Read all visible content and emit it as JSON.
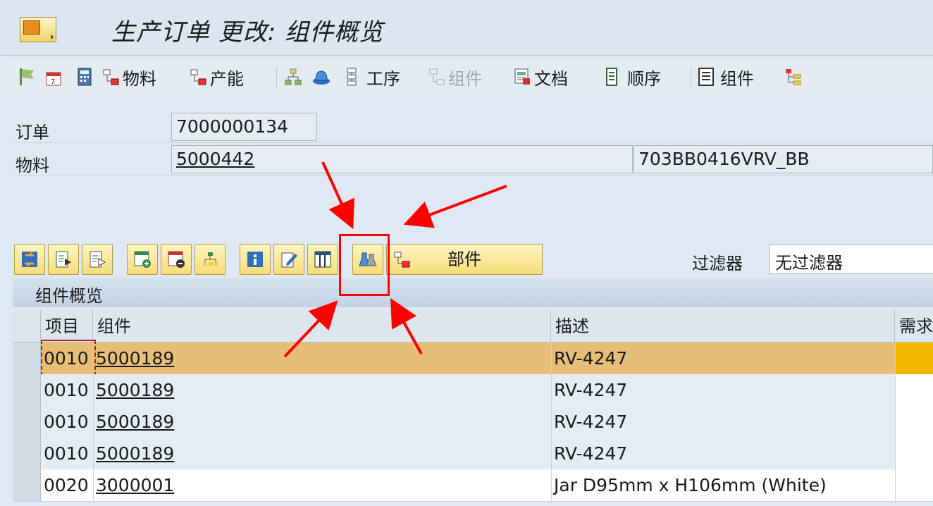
{
  "title": "生产订单 更改: 组件概览",
  "app_toolbar": {
    "material": "物料",
    "capacity": "产能",
    "operations": "工序",
    "components_disabled": "组件",
    "documents": "文档",
    "sequences": "顺序",
    "components": "组件"
  },
  "header": {
    "order_label": "订单",
    "order_value": "7000000134",
    "material_label": "物料",
    "material_value": "5000442",
    "material_desc": "703BB0416VRV_BB"
  },
  "grid_toolbar": {
    "parts_label": "部件",
    "filter_label": "过滤器",
    "filter_value": "无过滤器"
  },
  "grid": {
    "title": "组件概览",
    "columns": {
      "item": "项目",
      "component": "组件",
      "description": "描述",
      "requirement": "需求"
    },
    "rows": [
      {
        "item": "0010",
        "component": "5000189",
        "description": "RV-4247",
        "selected": true
      },
      {
        "item": "0010",
        "component": "5000189",
        "description": "RV-4247",
        "selected": false
      },
      {
        "item": "0010",
        "component": "5000189",
        "description": "RV-4247",
        "selected": false
      },
      {
        "item": "0010",
        "component": "5000189",
        "description": "RV-4247",
        "selected": false
      },
      {
        "item": "0020",
        "component": "3000001",
        "description": "Jar D95mm x H106mm (White)",
        "selected": false
      }
    ]
  },
  "colors": {
    "selected_row": "#e6be78",
    "highlight_box": "#ff0000",
    "requirement_cell": "#f5b800"
  }
}
